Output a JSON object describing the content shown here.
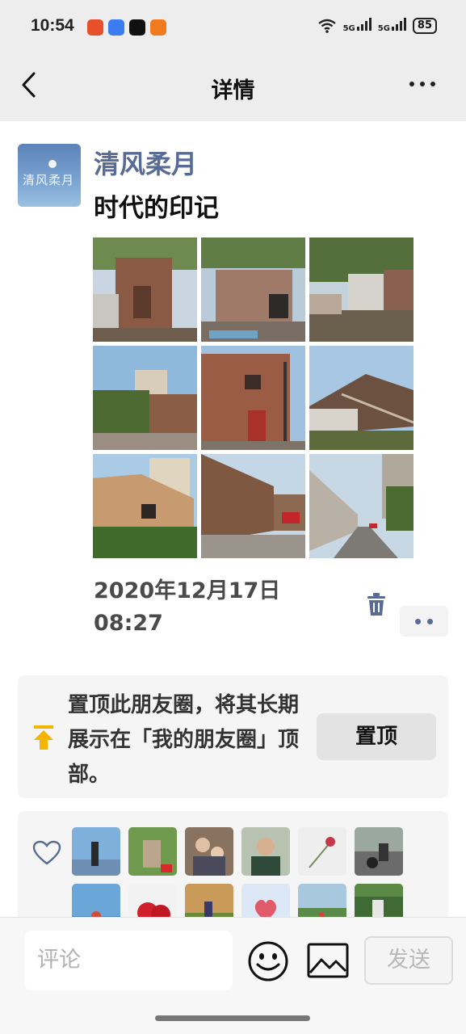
{
  "status_bar": {
    "time": "10:54",
    "signal_1": "5G",
    "signal_2": "5G",
    "battery": "85"
  },
  "nav": {
    "title": "详情",
    "back_icon": "chevron-left-icon",
    "more_icon": "ellipsis-icon"
  },
  "post": {
    "author": "清风柔月",
    "avatar_text": "清风柔月",
    "text": "时代的印记",
    "time_line1": "2020年12月17日",
    "time_line2": "08:27",
    "photo_count": 9
  },
  "pin": {
    "text": "置顶此朋友圈，将其长期展示在「我的朋友圈」顶部。",
    "button_label": "置顶"
  },
  "likes": {
    "icon": "heart-icon",
    "visible_avatar_count": 12
  },
  "comment_bar": {
    "placeholder": "评论",
    "send_label": "发送",
    "emoji_icon": "smiley-icon",
    "image_icon": "image-icon"
  },
  "colors": {
    "accent_name": "#576b95",
    "nav_bg": "#ededed",
    "card_bg": "#f5f5f5",
    "pin_icon": "#f5b400"
  }
}
